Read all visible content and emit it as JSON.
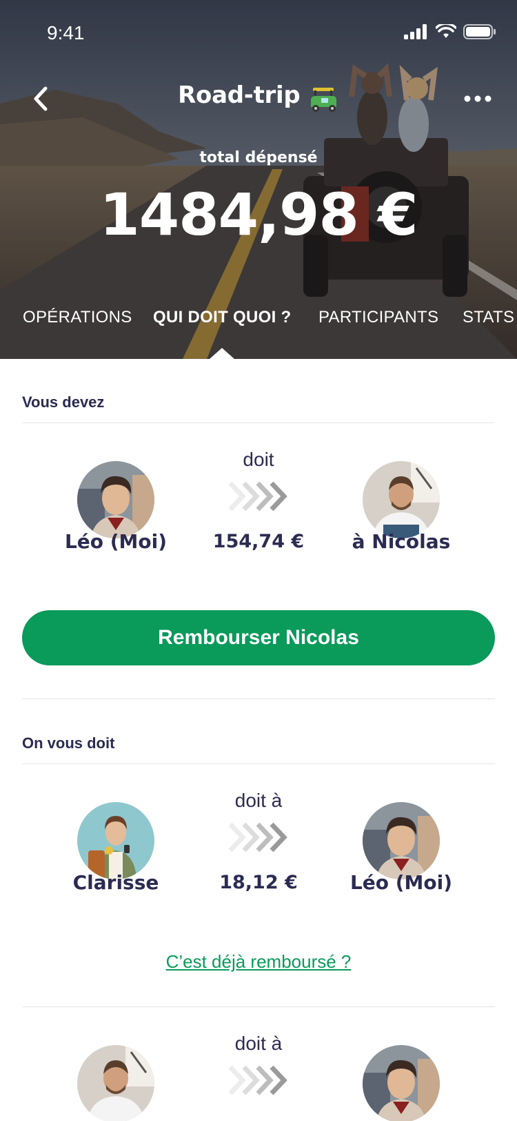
{
  "status": {
    "time": "9:41"
  },
  "header": {
    "title": "Road-trip",
    "title_icon": "tuktuk-emoji-icon",
    "total_label": "total dépensé",
    "total_value": "1484,98 €"
  },
  "tabs": [
    {
      "label": "OPÉRATIONS",
      "active": false
    },
    {
      "label": "QUI DOIT QUOI ?",
      "active": true
    },
    {
      "label": "PARTICIPANTS",
      "active": false
    },
    {
      "label": "STATS",
      "active": false
    }
  ],
  "you_owe": {
    "title": "Vous devez",
    "debtor": "Léo (Moi)",
    "verb": "doit",
    "amount": "154,74 €",
    "creditor": "à Nicolas",
    "button": "Rembourser Nicolas"
  },
  "owed_to_you": {
    "title": "On vous doit",
    "rows": [
      {
        "debtor": "Clarisse",
        "verb": "doit à",
        "amount": "18,12 €",
        "creditor": "Léo (Moi)",
        "link": "C’est déjà remboursé ?"
      },
      {
        "debtor": "",
        "verb": "doit à",
        "amount": "",
        "creditor": ""
      }
    ]
  },
  "colors": {
    "accent": "#0a9a5a",
    "text": "#2b2b52"
  }
}
